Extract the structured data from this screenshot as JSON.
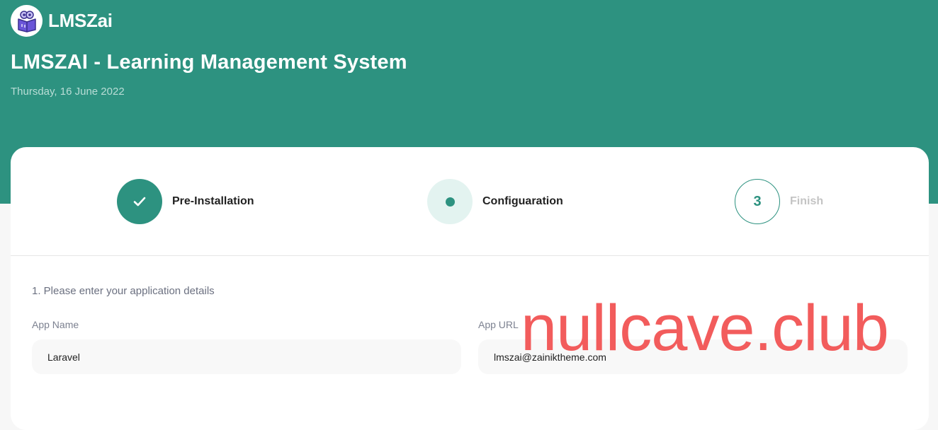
{
  "brand": {
    "name": "LMSZai",
    "logo_icon": "book-owl-icon"
  },
  "header": {
    "title": "LMSZAI - Learning Management System",
    "date": "Thursday, 16 June 2022"
  },
  "colors": {
    "primary": "#2d9280",
    "primary_light": "#e3f3f0",
    "page_bg": "#f7f7f7",
    "watermark": "#f25c5c"
  },
  "steps": [
    {
      "label": "Pre-Installation",
      "state": "completed",
      "icon": "check-icon"
    },
    {
      "label": "Configuaration",
      "state": "active",
      "icon": "dot-icon"
    },
    {
      "label": "Finish",
      "state": "pending",
      "number": "3"
    }
  ],
  "form": {
    "section_title": "1. Please enter your application details",
    "fields": [
      {
        "label": "App Name",
        "value": "Laravel"
      },
      {
        "label": "App URL",
        "value": "lmszai@zainiktheme.com"
      }
    ]
  },
  "watermark": "nullcave.club"
}
